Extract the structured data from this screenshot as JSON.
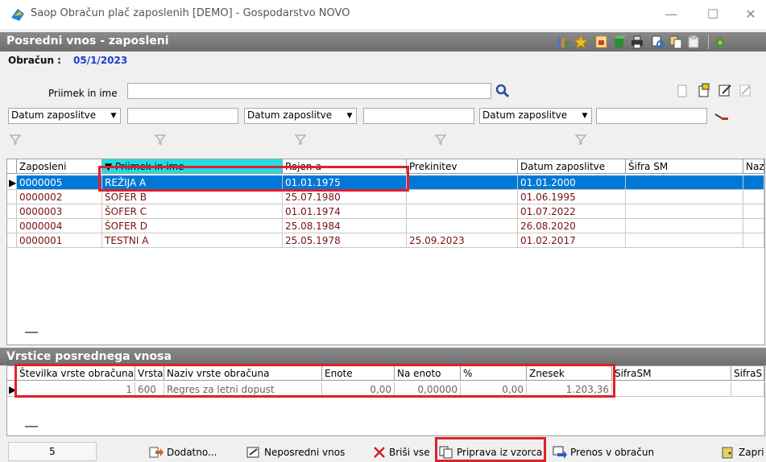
{
  "window": {
    "title": "Saop Obračun plač zaposlenih  [DEMO] - Gospodarstvo NOVO"
  },
  "form": {
    "title": "Posredni vnos - zaposleni",
    "obracun_label": "Obračun :",
    "obracun_value": "05/1/2023"
  },
  "filters": {
    "name_label": "Priimek in ime",
    "name_value": "",
    "date_selects": [
      "Datum zaposlitve",
      "Datum zaposlitve",
      "Datum zaposlitve"
    ]
  },
  "employees": {
    "columns": [
      "Zaposleni",
      "Priimek in ime",
      "Rojen-a",
      "Prekinitev",
      "Datum zaposlitve",
      "Šifra SM",
      "Naz"
    ],
    "rows": [
      [
        "0000005",
        "REŽIJA A",
        "01.01.1975",
        "",
        "01.01.2000",
        ""
      ],
      [
        "0000002",
        "ŠOFER B",
        "25.07.1980",
        "",
        "01.06.1995",
        ""
      ],
      [
        "0000003",
        "ŠOFER C",
        "01.01.1974",
        "",
        "01.07.2022",
        ""
      ],
      [
        "0000004",
        "ŠOFER D",
        "25.08.1984",
        "",
        "26.08.2020",
        ""
      ],
      [
        "0000001",
        "TESTNI A",
        "25.05.1978",
        "25.09.2023",
        "01.02.2017",
        ""
      ]
    ]
  },
  "lines": {
    "title": "Vrstice posrednega vnosa",
    "columns": [
      "Številka vrste obračuna",
      "Vrsta",
      "Naziv vrste obračuna",
      "Enote",
      "Na enoto",
      "%",
      "Znesek",
      "SifraSM",
      "SifraS"
    ],
    "rows": [
      [
        "1",
        "600",
        "Regres za letni dopust",
        "0,00",
        "0,00000",
        "0,00",
        "1.203,36",
        "",
        ""
      ]
    ]
  },
  "bottom": {
    "count": "5",
    "buttons": [
      "Dodatno...",
      "Neposredni vnos",
      "Briši vse",
      "Priprava iz vzorca",
      "Prenos v obračun",
      "Zapri"
    ]
  },
  "colors": {
    "selection": "#0078d7",
    "highlight": "#e0202c",
    "link": "#1a3fd0"
  }
}
